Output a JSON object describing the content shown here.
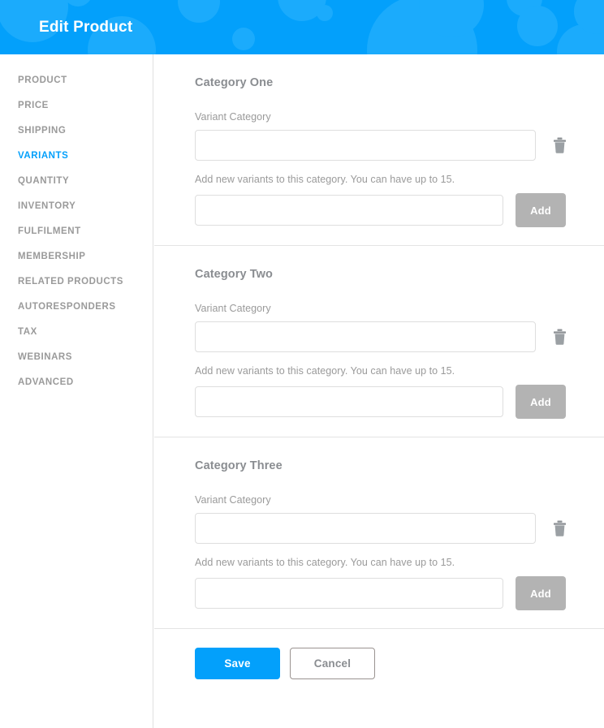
{
  "header": {
    "title": "Edit Product",
    "background_color": "#03A0FB",
    "pattern_circle_color": "#1BABFC"
  },
  "sidebar": {
    "items": [
      {
        "label": "PRODUCT",
        "active": false
      },
      {
        "label": "PRICE",
        "active": false
      },
      {
        "label": "SHIPPING",
        "active": false
      },
      {
        "label": "VARIANTS",
        "active": true
      },
      {
        "label": "QUANTITY",
        "active": false
      },
      {
        "label": "INVENTORY",
        "active": false
      },
      {
        "label": "FULFILMENT",
        "active": false
      },
      {
        "label": "MEMBERSHIP",
        "active": false
      },
      {
        "label": "RELATED PRODUCTS",
        "active": false
      },
      {
        "label": "AUTORESPONDERS",
        "active": false
      },
      {
        "label": "TAX",
        "active": false
      },
      {
        "label": "WEBINARS",
        "active": false
      },
      {
        "label": "ADVANCED",
        "active": false
      }
    ],
    "active_color": "#03A0FB",
    "inactive_color": "#9A9A9A"
  },
  "main": {
    "sections": [
      {
        "title": "Category One",
        "field_label": "Variant Category",
        "category_value": "",
        "category_placeholder": "",
        "delete_icon": "trash-icon",
        "helper_text": "Add new variants to this category. You can have up to 15.",
        "variant_value": "",
        "variant_placeholder": "",
        "add_label": "Add"
      },
      {
        "title": "Category Two",
        "field_label": "Variant Category",
        "category_value": "",
        "category_placeholder": "",
        "delete_icon": "trash-icon",
        "helper_text": "Add new variants to this category. You can have up to 15.",
        "variant_value": "",
        "variant_placeholder": "",
        "add_label": "Add"
      },
      {
        "title": "Category Three",
        "field_label": "Variant Category",
        "category_value": "",
        "category_placeholder": "",
        "delete_icon": "trash-icon",
        "helper_text": "Add new variants to this category. You can have up to 15.",
        "variant_value": "",
        "variant_placeholder": "",
        "add_label": "Add"
      }
    ],
    "max_variants": 15
  },
  "actions": {
    "save_label": "Save",
    "cancel_label": "Cancel",
    "save_color": "#03A0FB",
    "cancel_text_color": "#8A8D91"
  }
}
